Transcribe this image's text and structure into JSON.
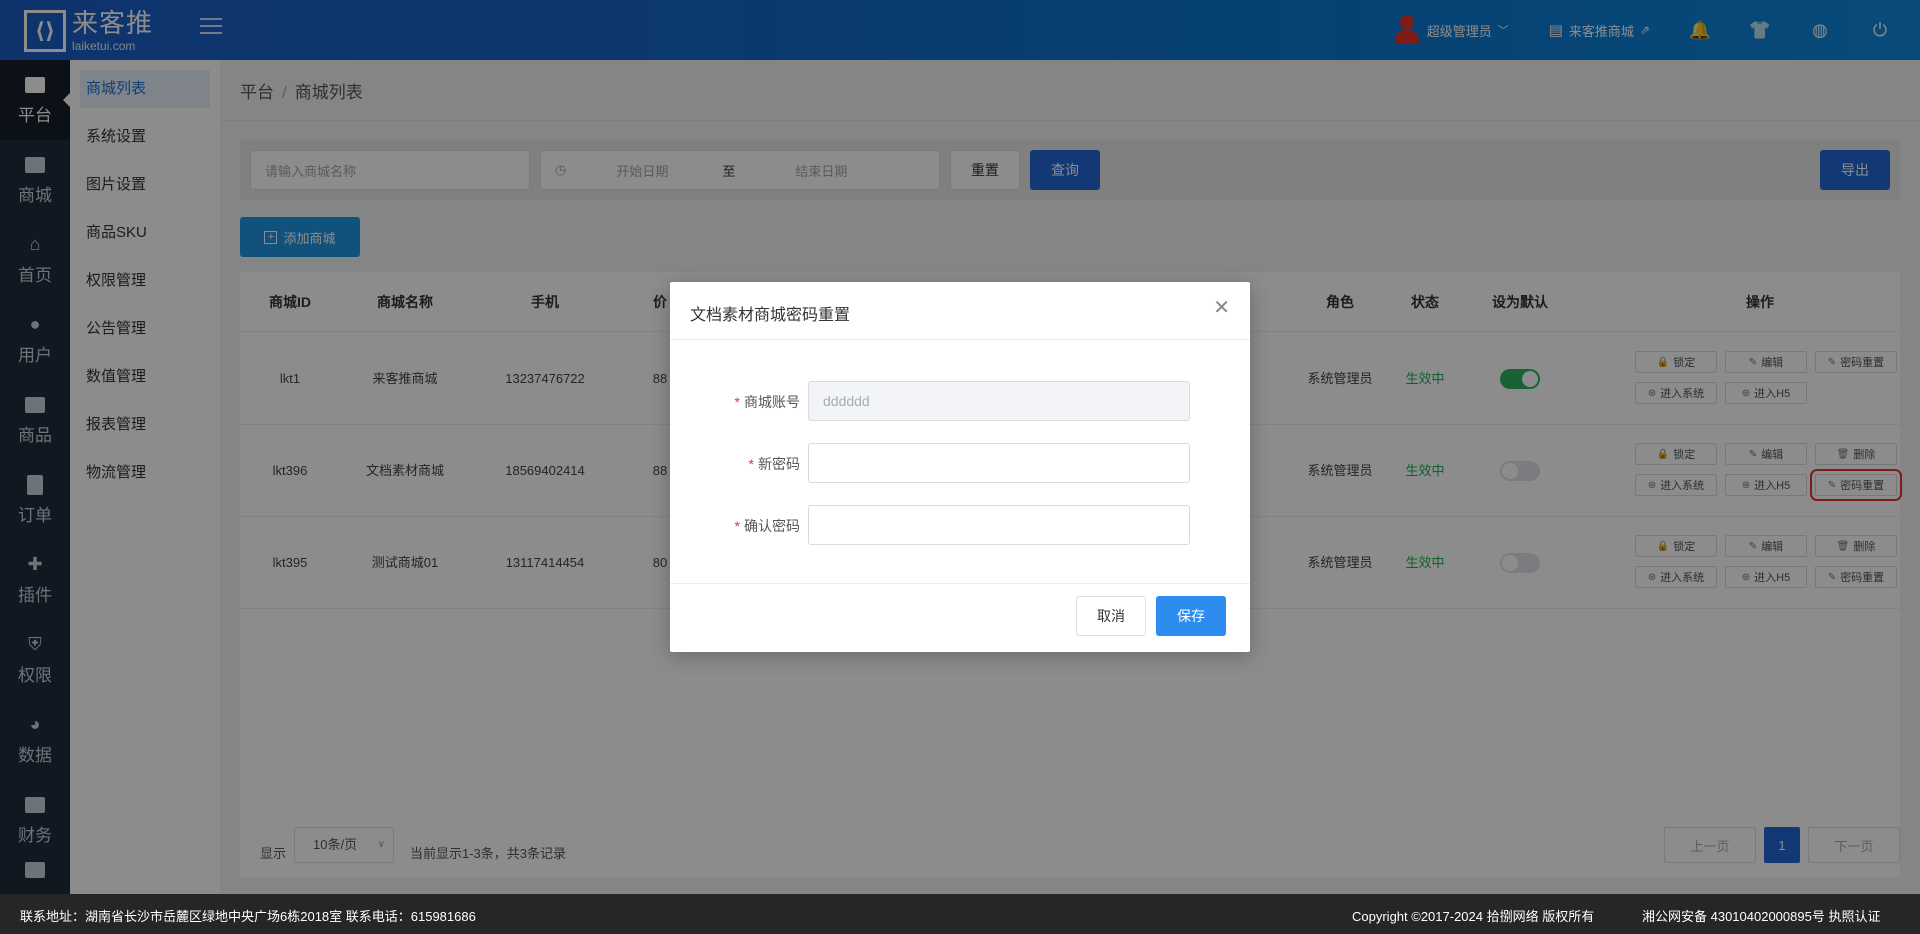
{
  "header": {
    "logo_name": "来客推",
    "logo_url": "laiketui.com",
    "user_label": "超级管理员",
    "shop_label": "来客推商城"
  },
  "nav": [
    {
      "label": "平台",
      "icon": "dollar-card-icon",
      "active": true
    },
    {
      "label": "商城",
      "icon": "store-icon"
    },
    {
      "label": "首页",
      "icon": "home-icon"
    },
    {
      "label": "用户",
      "icon": "user-icon"
    },
    {
      "label": "商品",
      "icon": "bag-icon"
    },
    {
      "label": "订单",
      "icon": "clipboard-icon"
    },
    {
      "label": "插件",
      "icon": "puzzle-icon"
    },
    {
      "label": "权限",
      "icon": "shield-icon"
    },
    {
      "label": "数据",
      "icon": "pie-icon"
    },
    {
      "label": "财务",
      "icon": "wallet-icon"
    }
  ],
  "subnav": [
    "商城列表",
    "系统设置",
    "图片设置",
    "商品SKU",
    "权限管理",
    "公告管理",
    "数值管理",
    "报表管理",
    "物流管理"
  ],
  "breadcrumb": {
    "root": "平台",
    "current": "商城列表"
  },
  "filter": {
    "name_placeholder": "请输入商城名称",
    "start_placeholder": "开始日期",
    "range_sep": "至",
    "end_placeholder": "结束日期",
    "reset_label": "重置",
    "query_label": "查询",
    "export_label": "导出"
  },
  "add_label": "添加商城",
  "table": {
    "headers": [
      "商城ID",
      "商城名称",
      "手机",
      "价",
      "角色",
      "状态",
      "设为默认",
      "操作"
    ],
    "rows": [
      {
        "id": "lkt1",
        "name": "来客推商城",
        "phone": "13237476722",
        "price": "88",
        "role": "系统管理员",
        "status": "生效中",
        "default": true,
        "ops1": [
          "锁定",
          "编辑",
          "密码重置"
        ],
        "ops2": [
          "进入系统",
          "进入H5"
        ]
      },
      {
        "id": "lkt396",
        "name": "文档素材商城",
        "phone": "18569402414",
        "price": "88",
        "role": "系统管理员",
        "status": "生效中",
        "default": false,
        "ops1": [
          "锁定",
          "编辑",
          "删除"
        ],
        "ops2": [
          "进入系统",
          "进入H5",
          "密码重置"
        ]
      },
      {
        "id": "lkt395",
        "name": "测试商城01",
        "phone": "13117414454",
        "price": "80",
        "role": "系统管理员",
        "status": "生效中",
        "default": false,
        "ops1": [
          "锁定",
          "编辑",
          "删除"
        ],
        "ops2": [
          "进入系统",
          "进入H5",
          "密码重置"
        ]
      }
    ]
  },
  "pager": {
    "show_label": "显示",
    "page_size": "10条/页",
    "summary": "当前显示1-3条，共3条记录",
    "prev_label": "上一页",
    "current_page": "1",
    "next_label": "下一页"
  },
  "modal": {
    "title": "文档素材商城密码重置",
    "account_label": "商城账号",
    "account_value": "dddddd",
    "new_pw_label": "新密码",
    "confirm_pw_label": "确认密码",
    "required_mark": "*",
    "cancel_label": "取消",
    "save_label": "保存"
  },
  "footer": {
    "address": "联系地址：湖南省长沙市岳麓区绿地中央广场6栋2018室 联系电话：615981686",
    "copyright": "Copyright ©2017-2024 拾捌网络 版权所有",
    "icp": "湘公网安备 43010402000895号 执照认证"
  }
}
